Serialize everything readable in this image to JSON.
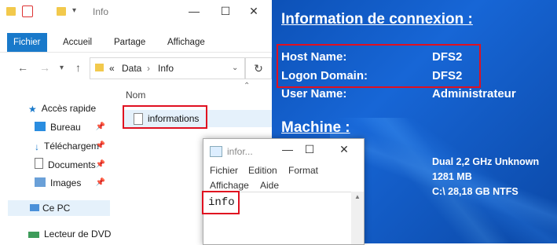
{
  "colors": {
    "desktop": "#0d52b8",
    "highlight": "#e01020",
    "ribbon_active": "#1979ca",
    "selection": "#e5f1fb"
  },
  "explorer": {
    "title": "Info",
    "ribbon_tabs": [
      "Fichier",
      "Accueil",
      "Partage",
      "Affichage"
    ],
    "breadcrumb": {
      "chevron": "«",
      "parts": [
        "Data",
        "Info"
      ]
    },
    "nav_items": [
      {
        "label": "Accès rapide",
        "icon": "star-icon"
      },
      {
        "label": "Bureau",
        "icon": "desktop-icon",
        "pinned": true
      },
      {
        "label": "Téléchargem",
        "icon": "download-icon",
        "pinned": true
      },
      {
        "label": "Documents",
        "icon": "document-icon",
        "pinned": true
      },
      {
        "label": "Images",
        "icon": "images-icon",
        "pinned": true
      },
      {
        "label": "Ce PC",
        "icon": "computer-icon"
      },
      {
        "label": "Lecteur de DVD",
        "icon": "dvd-icon"
      }
    ],
    "column_header": "Nom",
    "files": [
      {
        "name": "informations",
        "icon": "text-file-icon"
      }
    ]
  },
  "notepad": {
    "title": "infor...",
    "menu": [
      "Fichier",
      "Edition",
      "Format",
      "Affichage",
      "Aide"
    ],
    "content": "info"
  },
  "bginfo": {
    "title": "Information de connexion :",
    "fields": [
      {
        "label": "Host Name:",
        "value": "DFS2"
      },
      {
        "label": "Logon Domain:",
        "value": "DFS2"
      },
      {
        "label": "User Name:",
        "value": "Administrateur"
      }
    ],
    "machine_title": "Machine :",
    "machine_lines": [
      "Dual 2,2 GHz Unknown",
      "1281 MB",
      "C:\\ 28,18 GB NTFS"
    ]
  }
}
